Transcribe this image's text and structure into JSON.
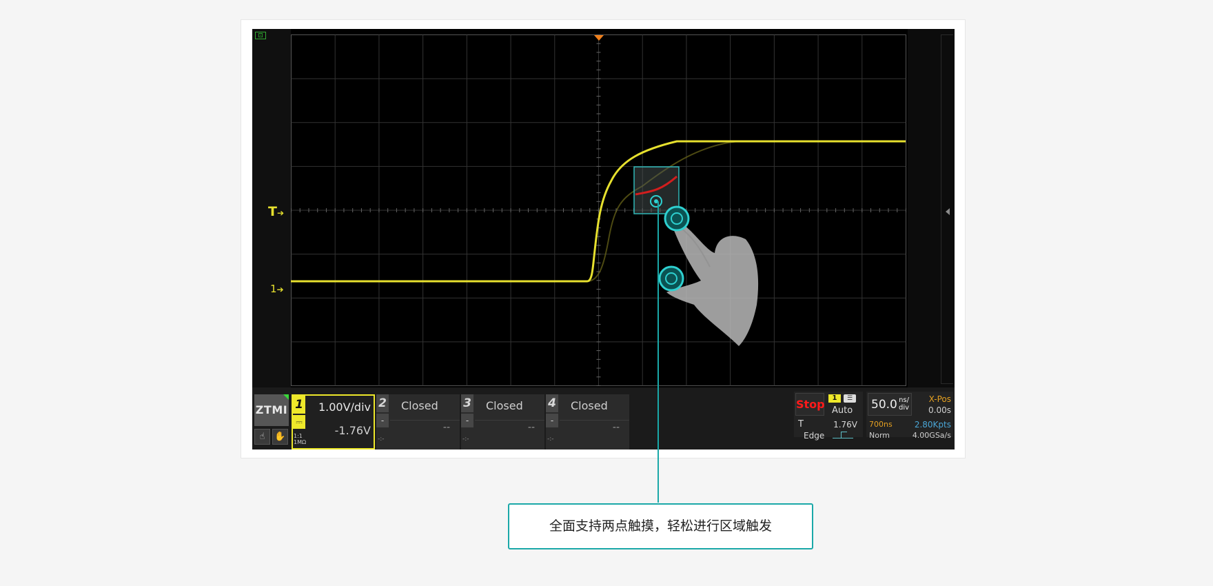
{
  "screen": {
    "trigger_marker": "T",
    "channel_marker": "1"
  },
  "bottom_bar": {
    "logo": "ZTMI",
    "channels": [
      {
        "number": "1",
        "scale": "1.00V/div",
        "offset": "-1.76V",
        "impedance_line1": "1:1",
        "impedance_line2": "1MΩ",
        "coupling": "DC",
        "active": true
      },
      {
        "number": "2",
        "label": "Closed",
        "offset": "--",
        "coupling": "-",
        "dots": "-:-"
      },
      {
        "number": "3",
        "label": "Closed",
        "offset": "--",
        "coupling": "-",
        "dots": "-:-"
      },
      {
        "number": "4",
        "label": "Closed",
        "offset": "--",
        "coupling": "-",
        "dots": "-:-"
      }
    ],
    "run_status": "Stop",
    "trigger_channel": "1",
    "trigger_mode": "Auto",
    "trigger_label": "T",
    "trigger_level": "1.76V",
    "trigger_type": "Edge",
    "timebase_value": "50.0",
    "timebase_unit_top": "ns/",
    "timebase_unit_bottom": "div",
    "xpos_label": "X-Pos",
    "xpos_value": "0.00s",
    "delay_value": "700ns",
    "memory_depth": "2.80Kpts",
    "acquire_mode": "Norm",
    "sample_rate": "4.00GSa/s"
  },
  "callout": {
    "text": "全面支持两点触摸，轻松进行区域触发"
  },
  "colors": {
    "trace_yellow": "#e6e02e",
    "accent_teal": "#1aa8a8",
    "stop_red": "#ff1a1a"
  }
}
